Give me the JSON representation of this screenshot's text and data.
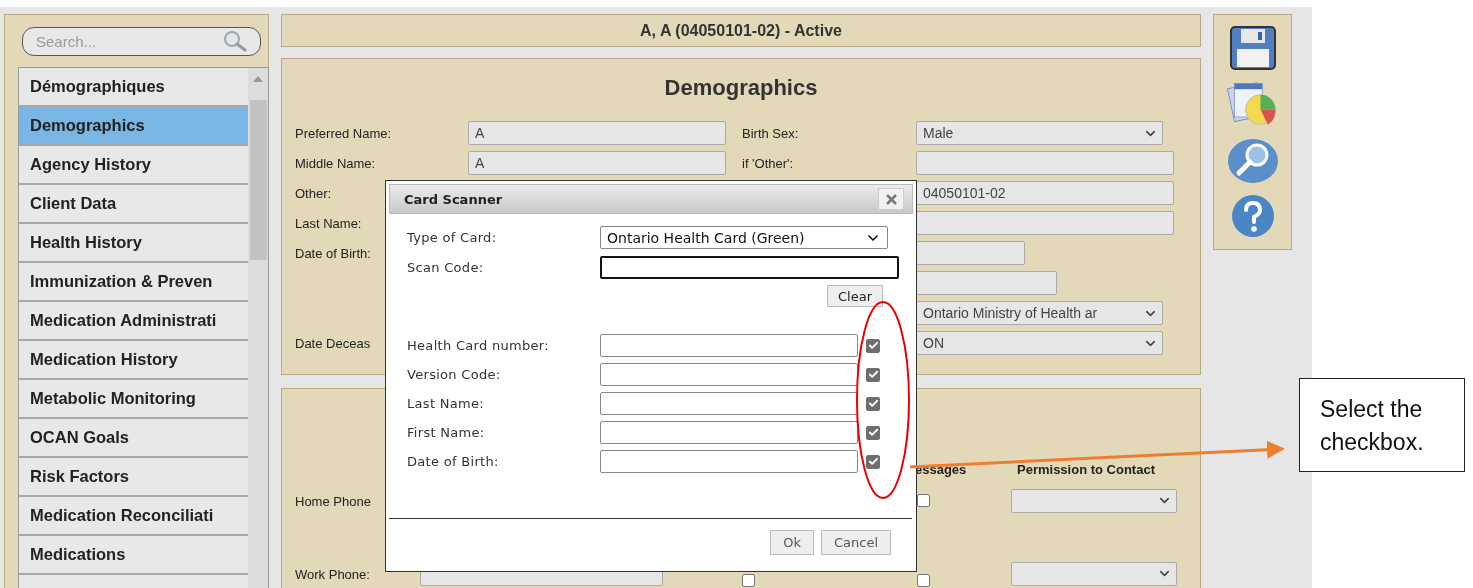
{
  "sidebar": {
    "search": {
      "placeholder": "Search..."
    },
    "items": [
      {
        "label": "Démographiques",
        "selected": false
      },
      {
        "label": "Demographics",
        "selected": true
      },
      {
        "label": "Agency History",
        "selected": false
      },
      {
        "label": "Client Data",
        "selected": false
      },
      {
        "label": "Health History",
        "selected": false
      },
      {
        "label": "Immunization & Preven",
        "selected": false
      },
      {
        "label": "Medication Administrati",
        "selected": false
      },
      {
        "label": "Medication History",
        "selected": false
      },
      {
        "label": "Metabolic Monitoring",
        "selected": false
      },
      {
        "label": "OCAN Goals",
        "selected": false
      },
      {
        "label": "Risk Factors",
        "selected": false
      },
      {
        "label": "Medication Reconciliati",
        "selected": false
      },
      {
        "label": "Medications",
        "selected": false
      },
      {
        "selected": false
      }
    ]
  },
  "header": {
    "title": "A, A (04050101-02) - Active"
  },
  "demographics": {
    "title": "Demographics",
    "rows": [
      {
        "left_label": "Preferred Name:",
        "left_field": {
          "value": "A"
        },
        "right_label": "Birth Sex:",
        "right_field": {
          "kind": "select",
          "value": "Male"
        }
      },
      {
        "left_label": "Middle Name:",
        "left_field": {
          "value": "A"
        },
        "right_label": "if 'Other':",
        "right_field": {
          "kind": "input"
        }
      },
      {
        "left_label": "Other:",
        "right_field": {
          "kind": "input",
          "value": "04050101-02"
        }
      },
      {
        "left_label": "Last Name:",
        "right_field": {
          "kind": "input"
        }
      },
      {
        "left_label": "Date of Birth:",
        "right_field": {
          "kind": "input"
        }
      },
      {
        "right_field": {
          "kind": "input"
        }
      },
      {
        "right_field": {
          "kind": "select",
          "value": "Ontario Ministry of Health ar"
        }
      },
      {
        "left_label": "Date Deceas",
        "right_field": {
          "kind": "select",
          "value": "ON"
        }
      }
    ]
  },
  "contact": {
    "headers": [
      "essages",
      "Permission to Contact"
    ],
    "rows": [
      {
        "label": "Home Phone",
        "fields": [
          {
            "kind": "checkbox",
            "checked": false
          },
          {
            "kind": "select"
          }
        ]
      },
      {
        "label": "Work Phone:",
        "fields": [
          {
            "kind": "input"
          },
          {
            "kind": "checkbox",
            "checked": false
          },
          {
            "kind": "checkbox",
            "checked": false
          },
          {
            "kind": "select"
          }
        ]
      }
    ]
  },
  "dialog": {
    "title": "Card Scanner",
    "card_type": {
      "label": "Type of Card:",
      "value": "Ontario Health Card (Green)"
    },
    "scan_code": {
      "label": "Scan Code:",
      "focused": true
    },
    "clear_button": "Clear",
    "fields": [
      {
        "label": "Health Card number:",
        "checked": true
      },
      {
        "label": "Version Code:",
        "checked": true
      },
      {
        "label": "Last Name:",
        "checked": true
      },
      {
        "label": "First Name:",
        "checked": true
      },
      {
        "label": "Date of Birth:",
        "checked": true
      }
    ],
    "buttons": [
      "Ok",
      "Cancel"
    ]
  },
  "annotation": {
    "callout": "Select the checkbox."
  }
}
